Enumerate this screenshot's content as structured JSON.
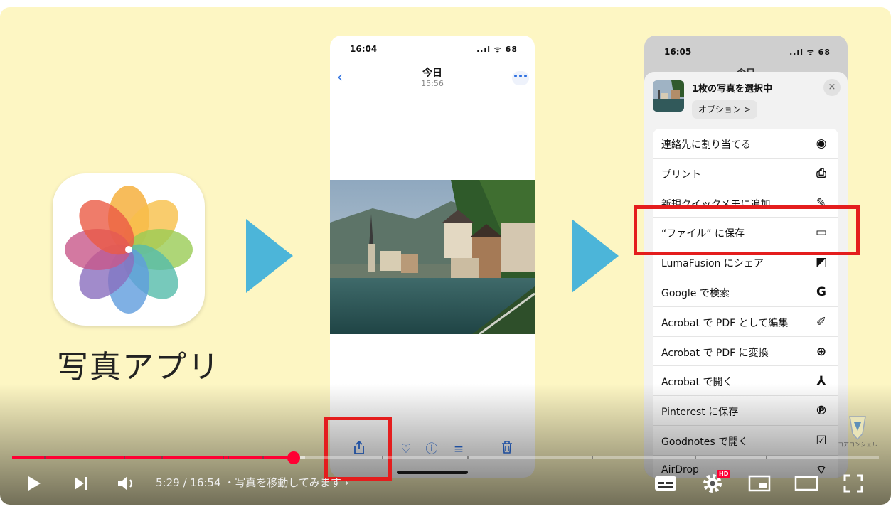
{
  "app": {
    "label": "写真アプリ",
    "icon": "photos-app-icon"
  },
  "phone1": {
    "status": {
      "time": "16:04",
      "icons": "..ıl ᯤ 68"
    },
    "header": {
      "title": "今日",
      "subtitle": "15:56"
    },
    "toolbar": [
      "share-icon",
      "heart-icon",
      "info-icon",
      "adjust-icon",
      "trash-icon"
    ]
  },
  "phone2": {
    "status": {
      "time": "16:05",
      "icons": "..ıl ᯤ 68"
    },
    "bg_title": "今日",
    "sheet": {
      "title": "1枚の写真を選択中",
      "options": "オプション >",
      "close": "×",
      "actions": [
        {
          "label": "連絡先に割り当てる",
          "icon": "◉"
        },
        {
          "label": "プリント",
          "icon": "⎙"
        },
        {
          "label": "新規クイックメモに追加",
          "icon": "✎"
        },
        {
          "label": "“ファイル” に保存",
          "icon": "▭"
        },
        {
          "label": "LumaFusion にシェア",
          "icon": "◩"
        },
        {
          "label": "Google で検索",
          "icon": "G"
        },
        {
          "label": "Acrobat で PDF として編集",
          "icon": "✐"
        },
        {
          "label": "Acrobat で PDF に変換",
          "icon": "⊕"
        },
        {
          "label": "Acrobat で開く",
          "icon": "⅄"
        },
        {
          "label": "Pinterest に保存",
          "icon": "℗"
        },
        {
          "label": "Goodnotes で開く",
          "icon": "☑"
        },
        {
          "label": "AirDrop",
          "icon": "⌔"
        }
      ]
    }
  },
  "watermark": {
    "text": "コアコンシェル"
  },
  "player": {
    "current_time": "5:29",
    "duration": "16:54",
    "chapter": "写真を移動してみます",
    "progress_fraction": 0.3245,
    "buffered_fraction": 0.338,
    "hd_badge": "HD",
    "colors": {
      "played": "#ff0033",
      "accent_arrow": "#4cb5d9",
      "highlight": "#e41d1d"
    }
  }
}
